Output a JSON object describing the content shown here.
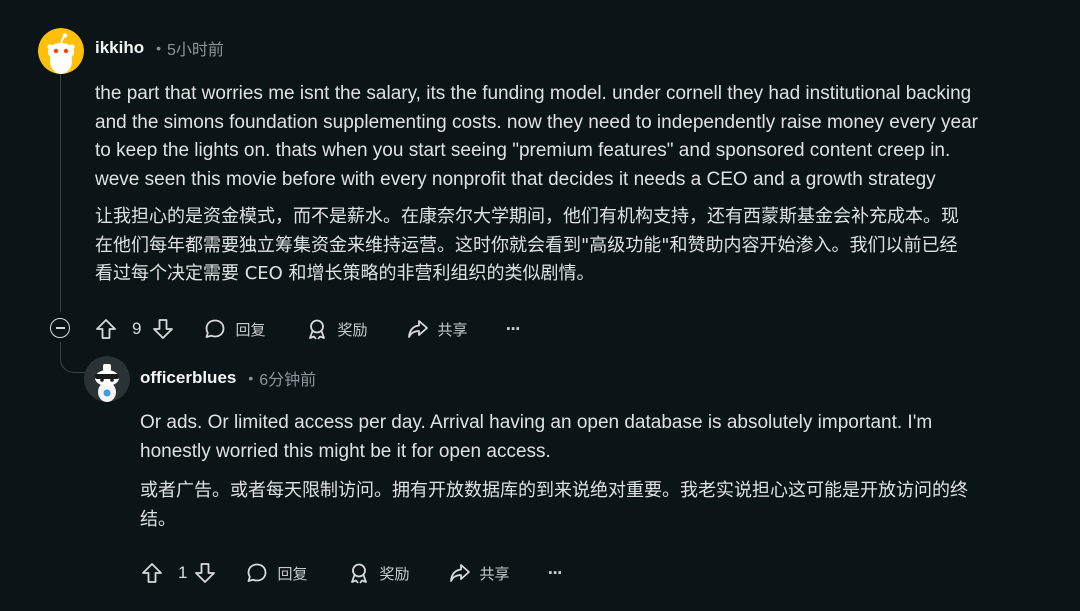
{
  "comments": [
    {
      "username": "ikkiho",
      "time": "5小时前",
      "body_en": "the part that worries me isnt the salary, its the funding model. under cornell they had institutional backing\nand the simons foundation supplementing costs. now they need to independently raise money every year\nto keep the lights on. thats when you start seeing \"premium features\" and sponsored content creep in.\nweve seen this movie before with every nonprofit that decides it needs a CEO and a growth strategy",
      "body_zh": "让我担心的是资金模式，而不是薪水。在康奈尔大学期间，他们有机构支持，还有西蒙斯基金会补充成本。现\n在他们每年都需要独立筹集资金来维持运营。这时你就会看到\"高级功能\"和赞助内容开始渗入。我们以前已经\n看过每个决定需要 CEO 和增长策略的非营利组织的类似剧情。",
      "votes": "9",
      "reply_label": "回复",
      "award_label": "奖励",
      "share_label": "共享",
      "more_label": "···"
    },
    {
      "username": "officerblues",
      "time": "6分钟前",
      "body_en": "Or ads. Or limited access per day. Arrival having an open database is absolutely important. I'm\nhonestly worried this might be it for open access.",
      "body_zh": "或者广告。或者每天限制访问。拥有开放数据库的到来说绝对重要。我老实说担心这可能是开放访问的终\n结。",
      "votes": "1",
      "reply_label": "回复",
      "award_label": "奖励",
      "share_label": "共享",
      "more_label": "···"
    }
  ],
  "icons": {
    "upvote": "arrow-up-icon",
    "downvote": "arrow-down-icon",
    "reply": "speech-bubble-icon",
    "award": "award-ribbon-icon",
    "share": "share-arrow-icon",
    "more": "ellipsis-icon",
    "collapse": "collapse-minus-icon"
  },
  "colors": {
    "background": "#0b1416",
    "avatar_yellow": "#ffbf0b",
    "text": "#dfe2e4",
    "muted": "#8b9599"
  }
}
